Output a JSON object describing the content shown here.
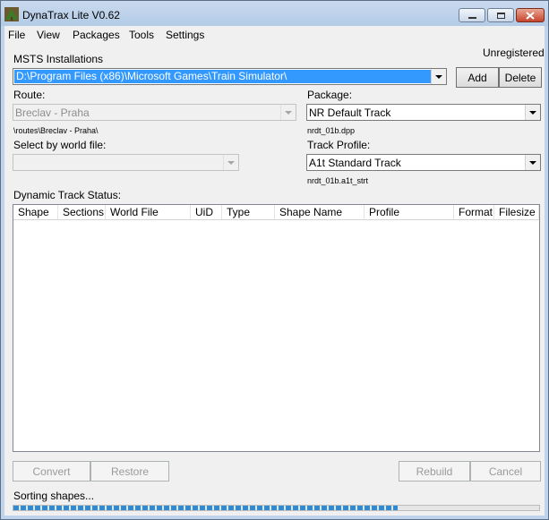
{
  "window": {
    "title": "DynaTrax Lite V0.62"
  },
  "menu": [
    "File",
    "View",
    "Packages",
    "Tools",
    "Settings"
  ],
  "registration_status": "Unregistered",
  "msts": {
    "label": "MSTS Installations",
    "selected": "D:\\Program Files (x86)\\Microsoft Games\\Train Simulator\\",
    "add_label": "Add",
    "delete_label": "Delete"
  },
  "route": {
    "label": "Route:",
    "selected": "Breclav - Praha",
    "path": "\\routes\\Breclav - Praha\\"
  },
  "package": {
    "label": "Package:",
    "selected": "NR Default Track",
    "file": "nrdt_01b.dpp"
  },
  "world_file": {
    "label": "Select by world file:",
    "selected": ""
  },
  "track_profile": {
    "label": "Track Profile:",
    "selected": "A1t Standard Track",
    "id": "nrdt_01b.a1t_strt"
  },
  "status_section": {
    "label": "Dynamic Track Status:",
    "columns": [
      "Shape",
      "Sections",
      "World File",
      "UiD",
      "Type",
      "Shape Name",
      "Profile",
      "Format",
      "Filesize"
    ]
  },
  "actions": {
    "convert": "Convert",
    "restore": "Restore",
    "rebuild": "Rebuild",
    "cancel": "Cancel"
  },
  "status_text": "Sorting shapes...",
  "progress": 0.73,
  "colors": {
    "selection": "#3399ff",
    "progress": "#2c8ad6",
    "frame": "#bfd3ea"
  }
}
